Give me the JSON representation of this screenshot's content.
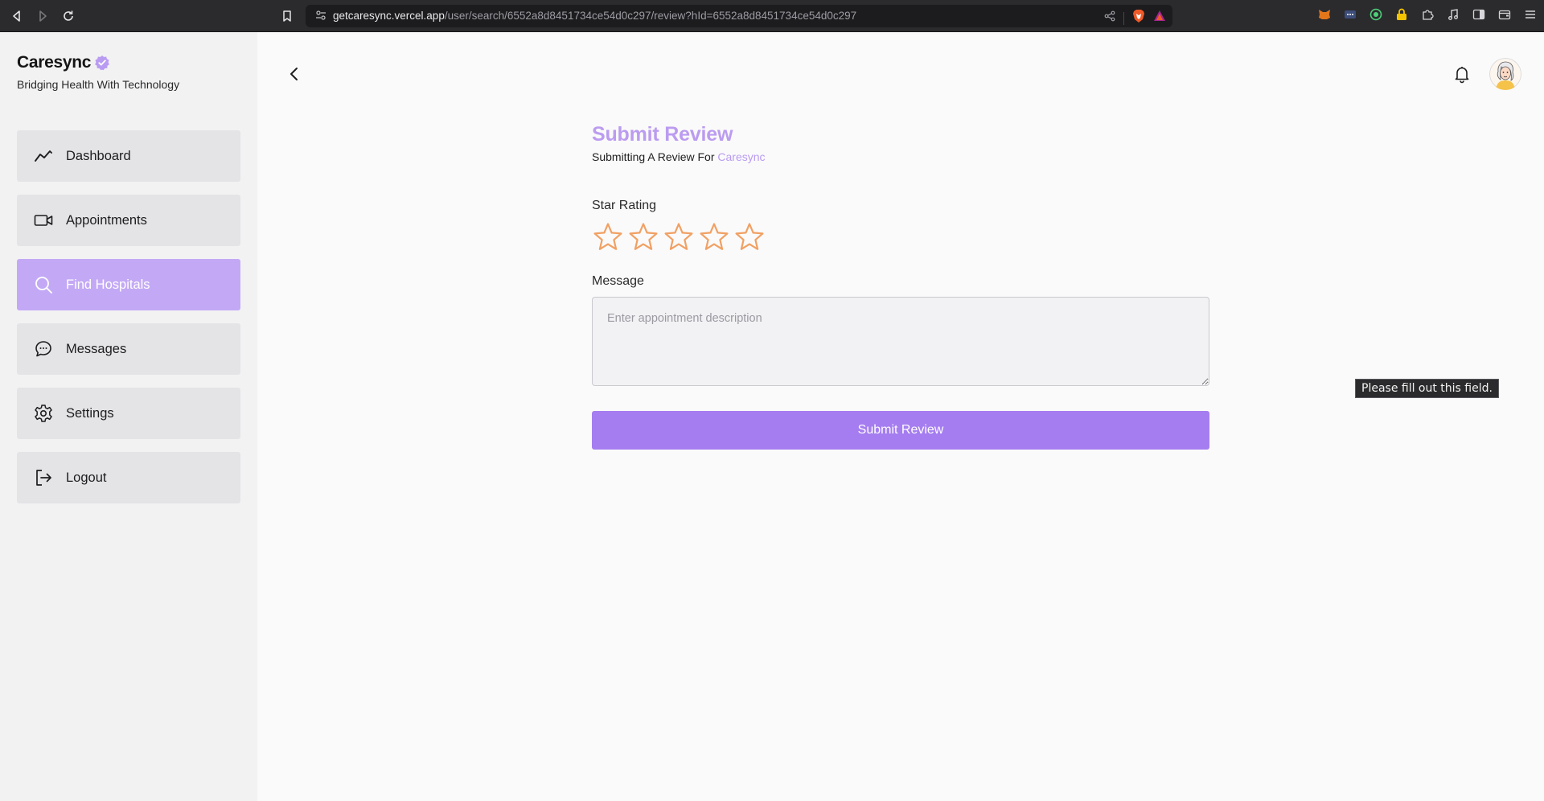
{
  "browser": {
    "url_host": "getcaresync.vercel.app",
    "url_path": "/user/search/6552a8d8451734ce54d0c297/review?hId=6552a8d8451734ce54d0c297",
    "icons": [
      "back-icon",
      "forward-icon",
      "reload-icon",
      "bookmark-icon",
      "site-settings-icon",
      "share-icon",
      "brave-shield-icon",
      "brave-rewards-icon",
      "metamask-icon",
      "extension-icon",
      "vpn-icon",
      "lock-icon",
      "puzzle-icon",
      "music-icon",
      "sidebar-icon",
      "wallet-icon",
      "menu-icon"
    ]
  },
  "sidebar": {
    "brand": "Caresync",
    "tagline": "Bridging Health With Technology",
    "items": [
      {
        "label": "Dashboard",
        "icon": "chart-line-icon",
        "active": false
      },
      {
        "label": "Appointments",
        "icon": "video-icon",
        "active": false
      },
      {
        "label": "Find Hospitals",
        "icon": "search-icon",
        "active": true
      },
      {
        "label": "Messages",
        "icon": "chat-icon",
        "active": false
      },
      {
        "label": "Settings",
        "icon": "gear-icon",
        "active": false
      },
      {
        "label": "Logout",
        "icon": "logout-icon",
        "active": false
      }
    ]
  },
  "header": {
    "icons": [
      "back-arrow-icon",
      "bell-icon",
      "avatar"
    ]
  },
  "form": {
    "title": "Submit Review",
    "subtitle_prefix": "Submitting A Review For",
    "subtitle_target": "Caresync",
    "rating_label": "Star Rating",
    "rating_max": 5,
    "rating_value": 0,
    "message_label": "Message",
    "message_placeholder": "Enter appointment description",
    "message_value": "",
    "submit_label": "Submit Review",
    "validation_tooltip": "Please fill out this field."
  },
  "colors": {
    "accent": "#a57df0",
    "accent_light": "#c3a9f5",
    "title": "#bb9cf0",
    "star": "#f1a063"
  }
}
